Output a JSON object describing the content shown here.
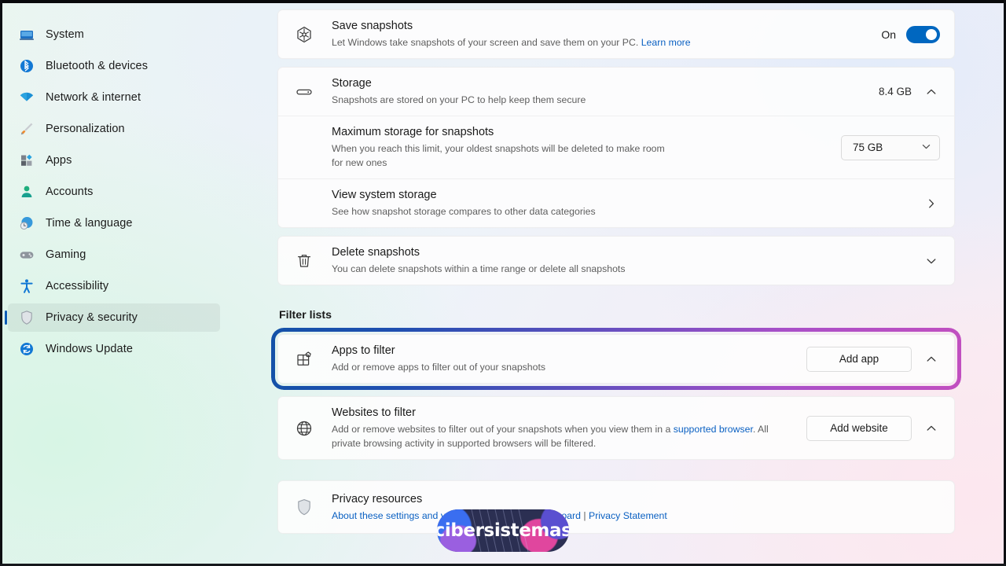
{
  "sidebar": {
    "items": [
      {
        "label": "System",
        "icon": "monitor-icon",
        "selected": false
      },
      {
        "label": "Bluetooth & devices",
        "icon": "bluetooth-icon",
        "selected": false
      },
      {
        "label": "Network & internet",
        "icon": "wifi-icon",
        "selected": false
      },
      {
        "label": "Personalization",
        "icon": "paintbrush-icon",
        "selected": false
      },
      {
        "label": "Apps",
        "icon": "apps-icon",
        "selected": false
      },
      {
        "label": "Accounts",
        "icon": "person-icon",
        "selected": false
      },
      {
        "label": "Time & language",
        "icon": "clock-globe-icon",
        "selected": false
      },
      {
        "label": "Gaming",
        "icon": "gamepad-icon",
        "selected": false
      },
      {
        "label": "Accessibility",
        "icon": "accessibility-icon",
        "selected": false
      },
      {
        "label": "Privacy & security",
        "icon": "shield-icon",
        "selected": true
      },
      {
        "label": "Windows Update",
        "icon": "update-icon",
        "selected": false
      }
    ]
  },
  "main": {
    "save_snapshots": {
      "title": "Save snapshots",
      "subtitle": "Let Windows take snapshots of your screen and save them on your PC.",
      "learn_more": "Learn more",
      "toggle_state": "On",
      "toggle_on": true
    },
    "storage": {
      "title": "Storage",
      "subtitle": "Snapshots are stored on your PC to help keep them secure",
      "value": "8.4 GB",
      "expanded": true,
      "max_storage": {
        "title": "Maximum storage for snapshots",
        "subtitle": "When you reach this limit, your oldest snapshots will be deleted to make room for new ones",
        "selected_option": "75 GB"
      },
      "view_system_storage": {
        "title": "View system storage",
        "subtitle": "See how snapshot storage compares to other data categories"
      }
    },
    "delete_snapshots": {
      "title": "Delete snapshots",
      "subtitle": "You can delete snapshots within a time range or delete all snapshots",
      "expanded": false
    },
    "filter_lists_heading": "Filter lists",
    "apps_to_filter": {
      "title": "Apps to filter",
      "subtitle": "Add or remove apps to filter out of your snapshots",
      "button_label": "Add app",
      "expanded": true,
      "highlighted": true
    },
    "websites_to_filter": {
      "title": "Websites to filter",
      "subtitle_part1": "Add or remove websites to filter out of your snapshots when you view them in a ",
      "subtitle_link": "supported browser",
      "subtitle_part2": ". All private browsing activity in supported browsers will be filtered.",
      "button_label": "Add website",
      "expanded": true
    },
    "privacy_resources": {
      "title": "Privacy resources",
      "link1": "About these settings and your privacy",
      "separator1": " | ",
      "link2": "Privacy dashboard",
      "separator2": " | ",
      "link3": "Privacy Statement"
    }
  },
  "watermark": {
    "text": "cibersistemas"
  },
  "colors": {
    "accent": "#0067C0",
    "link": "#0A60C2",
    "highlight_gradient_start": "#1451A8",
    "highlight_gradient_end": "#C14FC0",
    "selection_indicator": "#0D5BB5"
  }
}
